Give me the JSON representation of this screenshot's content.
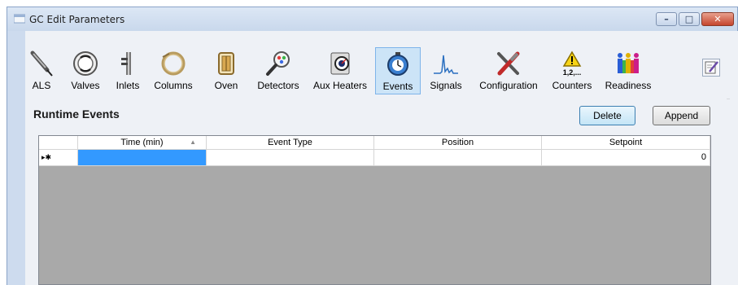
{
  "window": {
    "title": "GC Edit Parameters",
    "controls": {
      "minimize": "–",
      "maximize": "□",
      "close": "✕"
    }
  },
  "toolbar": {
    "items": [
      {
        "label": "ALS",
        "icon": "als-syringe-icon",
        "selected": false
      },
      {
        "label": "Valves",
        "icon": "valve-icon",
        "selected": false
      },
      {
        "label": "Inlets",
        "icon": "inlet-icon",
        "selected": false
      },
      {
        "label": "Columns",
        "icon": "column-coil-icon",
        "selected": false
      },
      {
        "label": "Oven",
        "icon": "oven-icon",
        "selected": false
      },
      {
        "label": "Detectors",
        "icon": "detector-magnifier-icon",
        "selected": false
      },
      {
        "label": "Aux Heaters",
        "icon": "aux-heater-gauge-icon",
        "selected": false
      },
      {
        "label": "Events",
        "icon": "events-stopwatch-icon",
        "selected": true
      },
      {
        "label": "Signals",
        "icon": "signal-peak-icon",
        "selected": false
      },
      {
        "label": "Configuration",
        "icon": "configuration-tools-icon",
        "selected": false
      },
      {
        "label": "Counters",
        "icon": "counters-warning-icon",
        "selected": false,
        "icon_text": "1,2,..."
      },
      {
        "label": "Readiness",
        "icon": "readiness-people-icon",
        "selected": false
      }
    ]
  },
  "panel": {
    "title": "Runtime Events",
    "delete_label": "Delete",
    "append_label": "Append"
  },
  "grid": {
    "columns": [
      "Time (min)",
      "Event Type",
      "Position",
      "Setpoint"
    ],
    "rows": [
      {
        "marker": "▸✱",
        "time": "",
        "event_type": "",
        "position": "",
        "setpoint": "0"
      }
    ]
  },
  "colors": {
    "selection": "#3399ff",
    "grid_background": "#a9a9a9",
    "selected_tool": "#cce4f7"
  }
}
